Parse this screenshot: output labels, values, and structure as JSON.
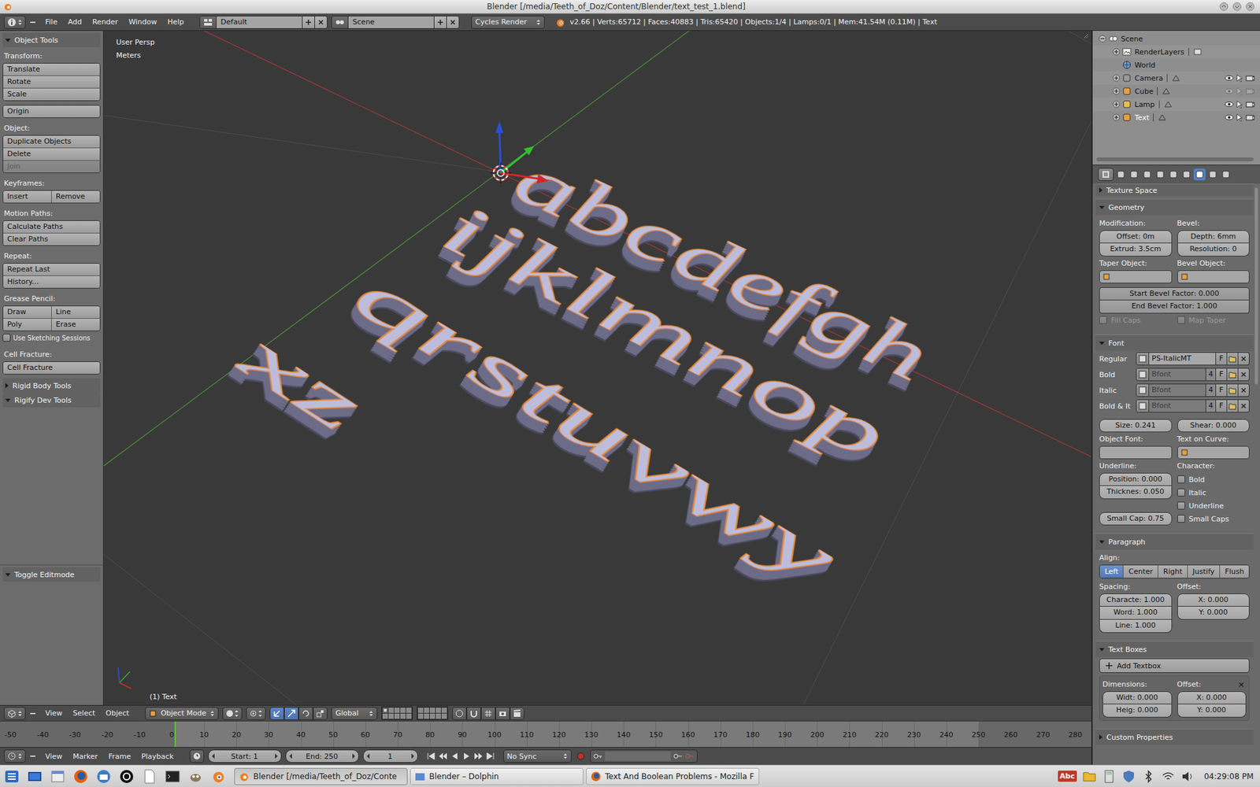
{
  "window": {
    "title": "Blender [/media/Teeth_of_Doz/Content/Blender/text_test_1.blend]"
  },
  "info_header": {
    "menus": [
      "File",
      "Add",
      "Render",
      "Window",
      "Help"
    ],
    "layout": "Default",
    "scene": "Scene",
    "engine": "Cycles Render",
    "stats": "v2.66 | Verts:65712 | Faces:40883 | Tris:65420 | Objects:1/4 | Lamps:0/1 | Mem:41.54M (0.11M) | Text"
  },
  "toolshelf": {
    "title": "Object Tools",
    "expanded": true,
    "items": [
      {
        "kind": "label",
        "text": "Transform:"
      },
      {
        "kind": "buttons",
        "rows": [
          [
            {
              "label": "Translate",
              "disabled": false
            }
          ],
          [
            {
              "label": "Rotate",
              "disabled": false
            }
          ],
          [
            {
              "label": "Scale",
              "disabled": false
            }
          ]
        ]
      },
      {
        "kind": "buttons",
        "rows": [
          [
            {
              "label": "Origin",
              "disabled": false
            }
          ]
        ]
      },
      {
        "kind": "label",
        "text": "Object:"
      },
      {
        "kind": "buttons",
        "rows": [
          [
            {
              "label": "Duplicate Objects",
              "disabled": false
            }
          ],
          [
            {
              "label": "Delete",
              "disabled": false
            }
          ],
          [
            {
              "label": "Join",
              "disabled": true
            }
          ]
        ]
      },
      {
        "kind": "label",
        "text": "Keyframes:"
      },
      {
        "kind": "buttons",
        "rows": [
          [
            {
              "label": "Insert",
              "disabled": false
            },
            {
              "label": "Remove",
              "disabled": false
            }
          ]
        ]
      },
      {
        "kind": "label",
        "text": "Motion Paths:"
      },
      {
        "kind": "buttons",
        "rows": [
          [
            {
              "label": "Calculate Paths",
              "disabled": false
            }
          ],
          [
            {
              "label": "Clear Paths",
              "disabled": false
            }
          ]
        ]
      },
      {
        "kind": "label",
        "text": "Repeat:"
      },
      {
        "kind": "buttons",
        "rows": [
          [
            {
              "label": "Repeat Last",
              "disabled": false
            }
          ],
          [
            {
              "label": "History...",
              "disabled": false
            }
          ]
        ]
      },
      {
        "kind": "label",
        "text": "Grease Pencil:"
      },
      {
        "kind": "buttons",
        "rows": [
          [
            {
              "label": "Draw",
              "disabled": false
            },
            {
              "label": "Line",
              "disabled": false
            }
          ],
          [
            {
              "label": "Poly",
              "disabled": false
            },
            {
              "label": "Erase",
              "disabled": false
            }
          ]
        ]
      },
      {
        "kind": "checkbox",
        "text": "Use Sketching Sessions",
        "checked": false
      },
      {
        "kind": "label",
        "text": "Cell Fracture:"
      },
      {
        "kind": "buttons",
        "rows": [
          [
            {
              "label": "Cell Fracture",
              "disabled": false
            }
          ]
        ]
      },
      {
        "kind": "panel",
        "text": "Rigid Body Tools",
        "expanded": false
      },
      {
        "kind": "panel",
        "text": "Rigify Dev Tools",
        "expanded": true
      }
    ],
    "operator_panel": {
      "title": "Toggle Editmode",
      "expanded": true
    }
  },
  "viewport": {
    "view": "User Persp",
    "units": "Meters",
    "object_label": "(1) Text",
    "text_object": {
      "lines": [
        "abcdefgh",
        "ijklmnop",
        "qrstuvwy",
        "xz"
      ],
      "selected": true
    }
  },
  "view_header": {
    "menus": [
      "View",
      "Select",
      "Object"
    ],
    "mode": "Object Mode",
    "orientation": "Global",
    "layers": [
      {
        "active": true
      },
      {
        "active": false
      },
      {
        "active": false
      },
      {
        "active": false
      },
      {
        "active": false
      },
      {
        "active": false
      },
      {
        "active": false
      },
      {
        "active": false
      },
      {
        "active": false
      },
      {
        "active": false
      },
      {
        "active": false
      },
      {
        "active": false
      },
      {
        "active": false
      },
      {
        "active": false
      },
      {
        "active": false
      },
      {
        "active": false
      },
      {
        "active": false
      },
      {
        "active": false
      },
      {
        "active": false
      },
      {
        "active": false
      }
    ]
  },
  "timeline": {
    "ticks": [
      "-50",
      "-40",
      "-30",
      "-20",
      "-10",
      "0",
      "10",
      "20",
      "30",
      "40",
      "50",
      "60",
      "70",
      "80",
      "90",
      "100",
      "110",
      "120",
      "130",
      "140",
      "150",
      "160",
      "170",
      "180",
      "190",
      "200",
      "210",
      "220",
      "230",
      "240",
      "250",
      "260",
      "270",
      "280"
    ],
    "menus": [
      "View",
      "Marker",
      "Frame",
      "Playback"
    ],
    "start": "Start: 1",
    "end": "End: 250",
    "current": "1",
    "sync": "No Sync"
  },
  "outliner": {
    "rows": [
      {
        "label": "Scene",
        "kind": "scene",
        "depth": 0,
        "has_children": true,
        "expanded": true,
        "active": false,
        "visible": true
      },
      {
        "label": "RenderLayers",
        "kind": "renderlayers",
        "depth": 1,
        "has_children": true,
        "expanded": false,
        "active": false,
        "visible": true
      },
      {
        "label": "World",
        "kind": "world",
        "depth": 1,
        "has_children": false,
        "expanded": false,
        "active": false,
        "visible": true
      },
      {
        "label": "Camera",
        "kind": "camera",
        "depth": 1,
        "has_children": true,
        "expanded": false,
        "active": false,
        "visible": true
      },
      {
        "label": "Cube",
        "kind": "mesh",
        "depth": 1,
        "has_children": true,
        "expanded": false,
        "active": false,
        "visible": false
      },
      {
        "label": "Lamp",
        "kind": "lamp",
        "depth": 1,
        "has_children": true,
        "expanded": false,
        "active": false,
        "visible": true
      },
      {
        "label": "Text",
        "kind": "text",
        "depth": 1,
        "has_children": true,
        "expanded": false,
        "active": true,
        "visible": true
      }
    ]
  },
  "properties": {
    "tabs": [
      {
        "selected": false
      },
      {
        "selected": false
      },
      {
        "selected": false
      },
      {
        "selected": false
      },
      {
        "selected": false
      },
      {
        "selected": false
      },
      {
        "selected": true
      },
      {
        "selected": false
      },
      {
        "selected": false
      }
    ],
    "cut_panel": {
      "title": "Texture Space",
      "expanded": false
    },
    "geometry": {
      "title": "Geometry",
      "expanded": true,
      "modification_label": "Modification:",
      "bevel_label": "Bevel:",
      "modification": [
        "Offset: 0m",
        "Extrud: 3.5cm"
      ],
      "bevel": [
        "Depth: 6mm",
        "Resolution: 0"
      ],
      "taper_label": "Taper Object:",
      "bevel_object_label": "Bevel Object:",
      "bevel_factors": [
        "Start Bevel Factor: 0.000",
        "End Bevel Factor: 1.000"
      ],
      "checks": [
        {
          "text": "Fill Caps",
          "checked": false,
          "disabled": true
        },
        {
          "text": "Map Taper",
          "checked": false,
          "disabled": true
        }
      ]
    },
    "font": {
      "title": "Font",
      "expanded": true,
      "faces": [
        {
          "label": "Regular",
          "name": "PS-ItalicMT",
          "users": "",
          "fake": "F",
          "linked": true
        },
        {
          "label": "Bold",
          "name": "Bfont",
          "users": "4",
          "fake": "F",
          "linked": false
        },
        {
          "label": "Italic",
          "name": "Bfont",
          "users": "4",
          "fake": "F",
          "linked": false
        },
        {
          "label": "Bold & It",
          "name": "Bfont",
          "users": "4",
          "fake": "F",
          "linked": false
        }
      ],
      "size": "Size: 0.241",
      "shear": "Shear: 0.000",
      "object_font_label": "Object Font:",
      "text_on_curve_label": "Text on Curve:",
      "underline_label": "Underline:",
      "underline": [
        "Position: 0.000",
        "Thicknes: 0.050"
      ],
      "small_cap": "Small Cap: 0.75",
      "character_label": "Character:",
      "character": [
        {
          "text": "Bold",
          "checked": false
        },
        {
          "text": "Italic",
          "checked": false
        },
        {
          "text": "Underline",
          "checked": false
        },
        {
          "text": "Small Caps",
          "checked": false
        }
      ]
    },
    "paragraph": {
      "title": "Paragraph",
      "expanded": true,
      "align_label": "Align:",
      "align": [
        {
          "label": "Left",
          "selected": true
        },
        {
          "label": "Center",
          "selected": false
        },
        {
          "label": "Right",
          "selected": false
        },
        {
          "label": "Justify",
          "selected": false
        },
        {
          "label": "Flush",
          "selected": false
        }
      ],
      "spacing_label": "Spacing:",
      "spacing": [
        "Characte: 1.000",
        "Word: 1.000",
        "Line: 1.000"
      ],
      "offset_label": "Offset:",
      "offset": [
        "X: 0.000",
        "Y: 0.000"
      ]
    },
    "text_boxes": {
      "title": "Text Boxes",
      "expanded": true,
      "add": "Add Textbox",
      "dimensions_label": "Dimensions:",
      "dimensions": [
        "Widt: 0.000",
        "Heig: 0.000"
      ],
      "offset_label": "Offset:",
      "offset": [
        "X: 0.000",
        "Y: 0.000"
      ],
      "remove": "×"
    },
    "custom_properties": {
      "title": "Custom Properties",
      "expanded": false
    }
  },
  "taskbar": {
    "tasks": [
      {
        "label": "Blender [/media/Teeth_of_Doz/Conte",
        "active": true
      },
      {
        "label": "Blender – Dolphin",
        "active": false
      },
      {
        "label": "Text And Boolean Problems - Mozilla F",
        "active": false
      }
    ],
    "spell_icon": "Abc",
    "clock": "04:29:08 PM"
  }
}
